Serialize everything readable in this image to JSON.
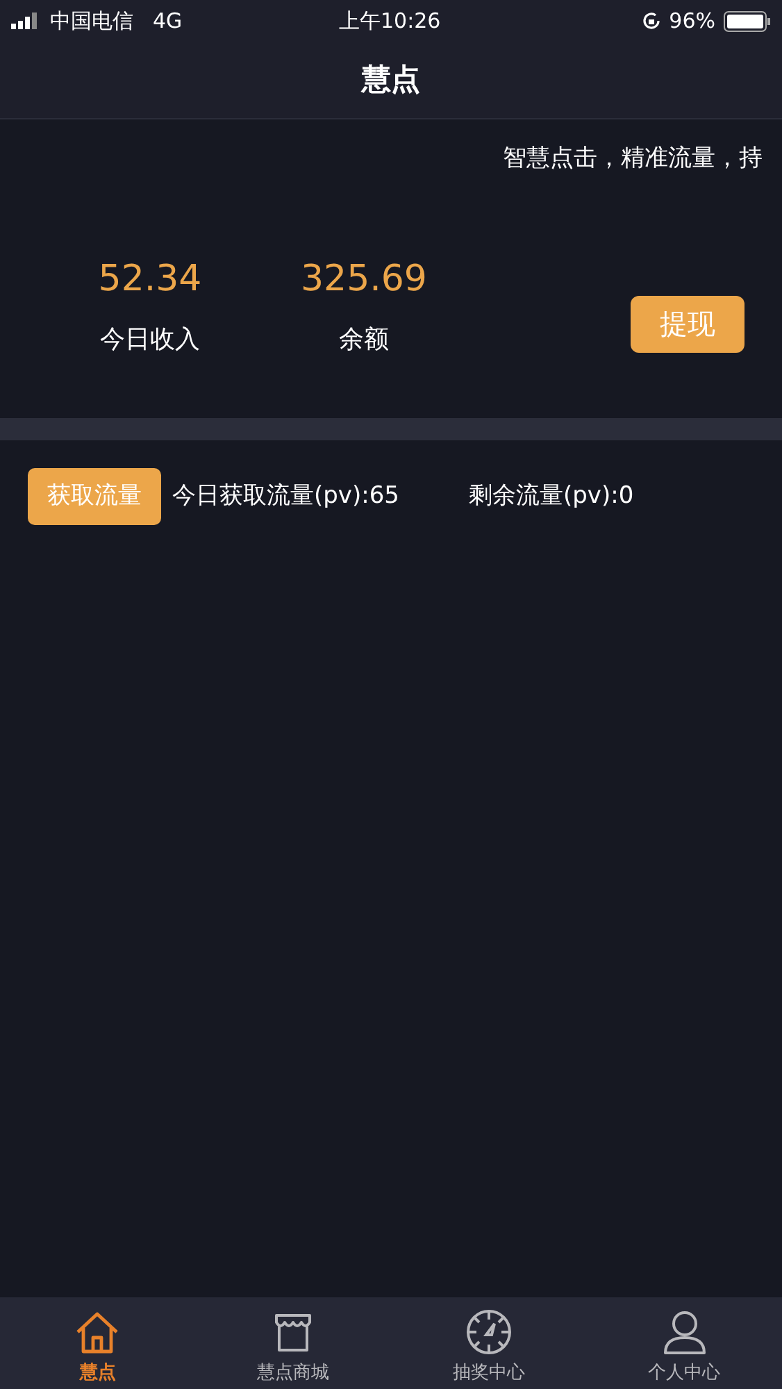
{
  "status_bar": {
    "carrier": "中国电信",
    "network": "4G",
    "time": "上午10:26",
    "battery": "96%"
  },
  "nav": {
    "title": "慧点"
  },
  "marquee": "智慧点击，精准流量，持",
  "stats": [
    {
      "value": "52.34",
      "label": "今日收入"
    },
    {
      "value": "325.69",
      "label": "余额"
    }
  ],
  "withdraw_button": "提现",
  "traffic": {
    "button": "获取流量",
    "today": "今日获取流量(pv):65",
    "remaining": "剩余流量(pv):0"
  },
  "tabs": [
    {
      "kind": "home",
      "label": "慧点",
      "selected": true
    },
    {
      "kind": "shop",
      "label": "慧点商城",
      "selected": false
    },
    {
      "kind": "wheel",
      "label": "抽奖中心",
      "selected": false
    },
    {
      "kind": "person",
      "label": "个人中心",
      "selected": false
    }
  ]
}
